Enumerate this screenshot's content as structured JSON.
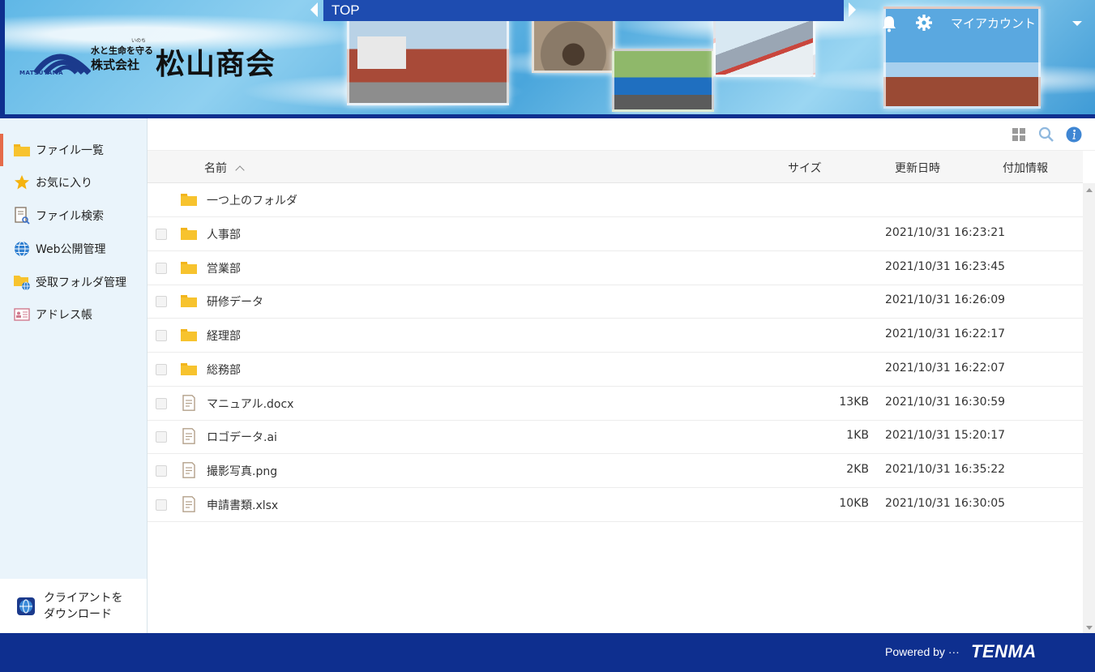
{
  "header": {
    "logo": {
      "small_text": "MATSUYAMA",
      "ruby": "いのち",
      "tagline": "水と生命を守る",
      "company_type": "株式会社",
      "company_name": "松山商会"
    },
    "tab_label": "TOP",
    "account_label": "マイアカウント"
  },
  "sidebar": {
    "items": [
      {
        "label": "ファイル一覧",
        "icon": "folder-icon",
        "active": true
      },
      {
        "label": "お気に入り",
        "icon": "star-icon"
      },
      {
        "label": "ファイル検索",
        "icon": "file-search-icon"
      },
      {
        "label": "Web公開管理",
        "icon": "globe-icon"
      },
      {
        "label": "受取フォルダ管理",
        "icon": "folder-globe-icon"
      },
      {
        "label": "アドレス帳",
        "icon": "address-book-icon"
      }
    ],
    "download": {
      "line1": "クライアントを",
      "line2": "ダウンロード"
    }
  },
  "table": {
    "headers": {
      "name": "名前",
      "size": "サイズ",
      "updated": "更新日時",
      "extra": "付加情報"
    },
    "parent_folder": "一つ上のフォルダ",
    "rows": [
      {
        "type": "folder",
        "name": "人事部",
        "size": "",
        "date": "2021/10/31 16:23:21"
      },
      {
        "type": "folder",
        "name": "営業部",
        "size": "",
        "date": "2021/10/31 16:23:45"
      },
      {
        "type": "folder",
        "name": "研修データ",
        "size": "",
        "date": "2021/10/31 16:26:09"
      },
      {
        "type": "folder",
        "name": "経理部",
        "size": "",
        "date": "2021/10/31 16:22:17"
      },
      {
        "type": "folder",
        "name": "総務部",
        "size": "",
        "date": "2021/10/31 16:22:07"
      },
      {
        "type": "file",
        "name": "マニュアル.docx",
        "size": "13KB",
        "date": "2021/10/31 16:30:59"
      },
      {
        "type": "file",
        "name": "ロゴデータ.ai",
        "size": "1KB",
        "date": "2021/10/31 15:20:17"
      },
      {
        "type": "file",
        "name": "撮影写真.png",
        "size": "2KB",
        "date": "2021/10/31 16:35:22"
      },
      {
        "type": "file",
        "name": "申請書類.xlsx",
        "size": "10KB",
        "date": "2021/10/31 16:30:05"
      }
    ]
  },
  "footer": {
    "powered": "Powered by ···",
    "brand": "TENMA"
  },
  "colors": {
    "header_blue": "#0e2f8f",
    "tab_blue": "#1e4cb0",
    "folder": "#f7c32e",
    "accent": "#e56b4a"
  }
}
